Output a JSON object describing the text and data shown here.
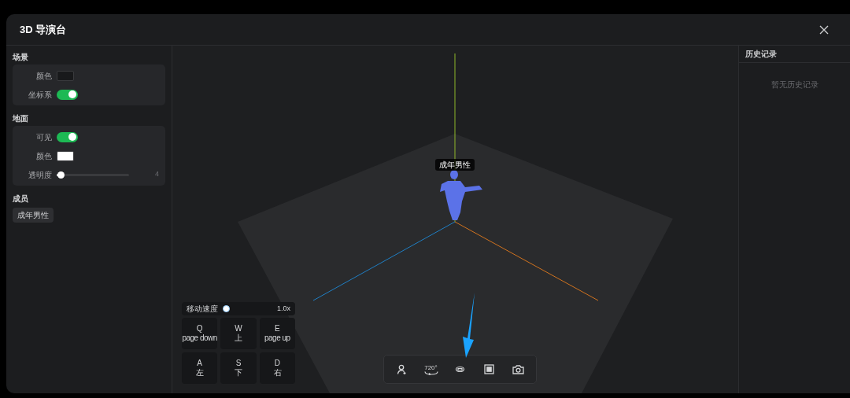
{
  "window": {
    "title": "3D 导演台"
  },
  "scene": {
    "heading": "场景",
    "fields": [
      {
        "kind": "color",
        "label": "颜色",
        "color": "#18191b"
      },
      {
        "kind": "toggle",
        "label": "坐标系",
        "on": true
      }
    ]
  },
  "ground": {
    "heading": "地面",
    "fields": [
      {
        "kind": "toggle",
        "label": "可见",
        "on": true
      },
      {
        "kind": "color",
        "label": "颜色",
        "color": "#ffffff"
      },
      {
        "kind": "slider",
        "label": "透明度",
        "level": 0.05,
        "reading": "4"
      }
    ]
  },
  "members": {
    "heading": "成员",
    "items": [
      {
        "label": "成年男性"
      }
    ]
  },
  "viewport": {
    "figure_label": "成年男性",
    "speed": {
      "label": "移动速度",
      "level": 0,
      "reading": "1.0x"
    },
    "keys": [
      {
        "key": "Q",
        "action": "page down"
      },
      {
        "key": "W",
        "action": "上"
      },
      {
        "key": "E",
        "action": "page up"
      },
      {
        "key": "A",
        "action": "左"
      },
      {
        "key": "S",
        "action": "下"
      },
      {
        "key": "D",
        "action": "右"
      }
    ],
    "toolbar": [
      {
        "kind": "person"
      },
      {
        "kind": "rotate",
        "label": "720°"
      },
      {
        "kind": "orbit"
      },
      {
        "kind": "frame"
      },
      {
        "kind": "camera"
      }
    ]
  },
  "history": {
    "title": "历史记录",
    "empty_text": "暂无历史记录"
  }
}
